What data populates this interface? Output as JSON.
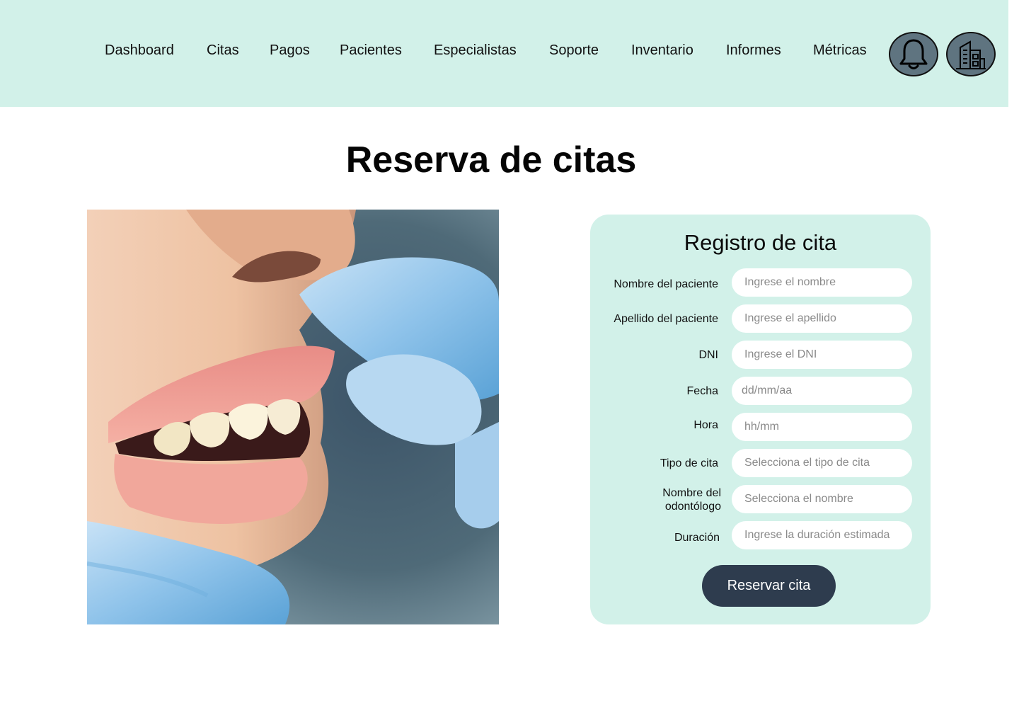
{
  "nav": {
    "items": [
      "Dashboard",
      "Citas",
      "Pagos",
      "Pacientes",
      "Especialistas",
      "Soporte",
      "Inventario",
      "Informes",
      "Métricas"
    ],
    "icons": [
      "bell-icon",
      "building-icon"
    ]
  },
  "page": {
    "title": "Reserva de citas"
  },
  "form": {
    "title": "Registro de cita",
    "fields": [
      {
        "label": "Nombre del paciente",
        "placeholder": "Ingrese el nombre"
      },
      {
        "label": "Apellido del paciente",
        "placeholder": "Ingrese el apellido"
      },
      {
        "label": "DNI",
        "placeholder": "Ingrese el DNI"
      },
      {
        "label": "Fecha",
        "placeholder": "dd/mm/aa"
      },
      {
        "label": "Hora",
        "placeholder": "hh/mm"
      },
      {
        "label": "Tipo de cita",
        "placeholder": "Selecciona el tipo de cita"
      },
      {
        "label": "Nombre del odontólogo",
        "placeholder": "Selecciona el nombre"
      },
      {
        "label": "Duración",
        "placeholder": "Ingrese la duración estimada"
      }
    ],
    "submit_label": "Reservar cita"
  },
  "colors": {
    "mint": "#d2f1e9",
    "navy_button": "#2e3c4e",
    "icon_button": "#5f7480",
    "glove_blue": "#8fc3ea"
  }
}
